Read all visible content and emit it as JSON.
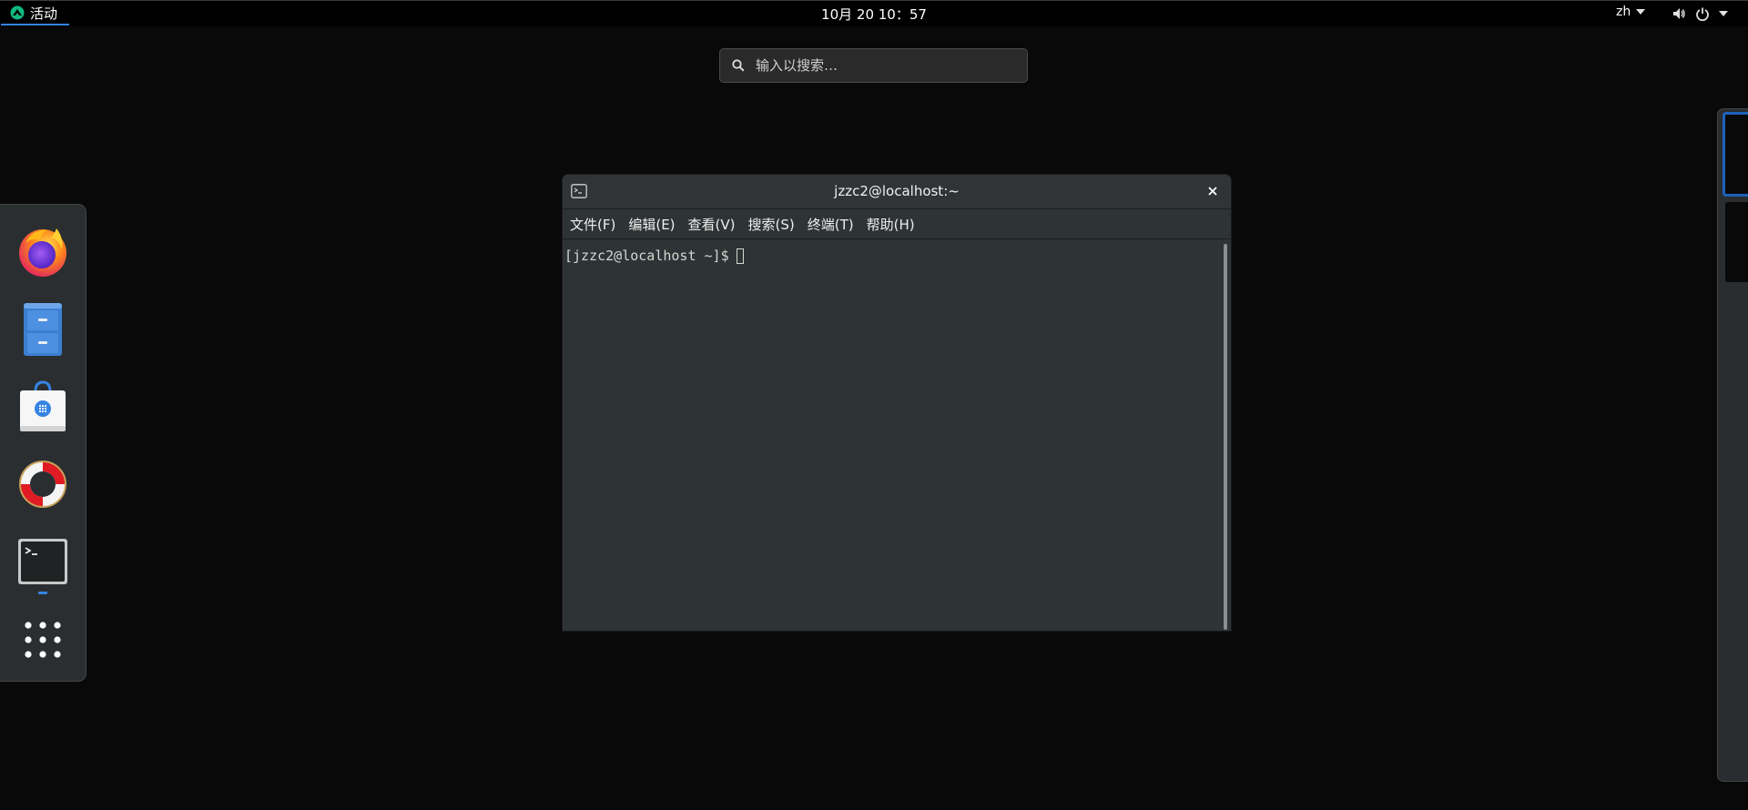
{
  "topbar": {
    "activities_label": "活动",
    "clock": "10月 20  10：57",
    "lang": "zh",
    "icons": [
      "volume-icon",
      "power-icon"
    ]
  },
  "search": {
    "placeholder": "输入以搜索…"
  },
  "dash": {
    "apps": [
      "firefox",
      "files",
      "software",
      "help",
      "terminal",
      "show-applications"
    ],
    "running_indicator_color": "#3584e4"
  },
  "terminal": {
    "title": "jzzc2@localhost:~",
    "menu": [
      "文件(F)",
      "编辑(E)",
      "查看(V)",
      "搜索(S)",
      "终端(T)",
      "帮助(H)"
    ],
    "prompt": "[jzzc2@localhost ~]$"
  },
  "colors": {
    "desktop_bg": "#090909",
    "accent": "#3584e4",
    "window_bg": "#2e3436"
  }
}
